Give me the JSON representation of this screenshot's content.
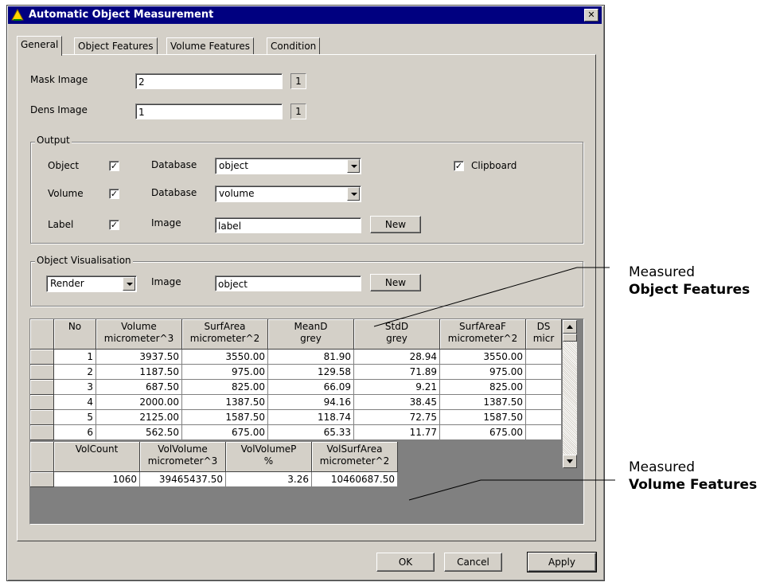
{
  "window": {
    "title": "Automatic Object Measurement",
    "close_glyph": "✕"
  },
  "tabs": [
    {
      "label": "General",
      "active": true
    },
    {
      "label": "Object Features",
      "active": false
    },
    {
      "label": "Volume Features",
      "active": false
    },
    {
      "label": "Condition",
      "active": false
    }
  ],
  "general": {
    "mask_image": {
      "label": "Mask Image",
      "value": "2",
      "channel": "1"
    },
    "dens_image": {
      "label": "Dens Image",
      "value": "1",
      "channel": "1"
    }
  },
  "output": {
    "group_label": "Output",
    "object": {
      "label": "Object",
      "checked": true,
      "field_label": "Database",
      "value": "object"
    },
    "volume": {
      "label": "Volume",
      "checked": true,
      "field_label": "Database",
      "value": "volume"
    },
    "label": {
      "label": "Label",
      "checked": true,
      "field_label": "Image",
      "value": "label",
      "button": "New"
    },
    "clipboard": {
      "label": "Clipboard",
      "checked": true
    }
  },
  "visualisation": {
    "group_label": "Object Visualisation",
    "mode": "Render",
    "field_label": "Image",
    "value": "object",
    "button": "New"
  },
  "object_table": {
    "headers": [
      {
        "top": "No",
        "bottom": ""
      },
      {
        "top": "Volume",
        "bottom": "micrometer^3"
      },
      {
        "top": "SurfArea",
        "bottom": "micrometer^2"
      },
      {
        "top": "MeanD",
        "bottom": "grey"
      },
      {
        "top": "StdD",
        "bottom": "grey"
      },
      {
        "top": "SurfAreaF",
        "bottom": "micrometer^2"
      },
      {
        "top": "DS",
        "bottom": "micr"
      }
    ],
    "rows": [
      [
        "1",
        "3937.50",
        "3550.00",
        "81.90",
        "28.94",
        "3550.00",
        ""
      ],
      [
        "2",
        "1187.50",
        "975.00",
        "129.58",
        "71.89",
        "975.00",
        ""
      ],
      [
        "3",
        "687.50",
        "825.00",
        "66.09",
        "9.21",
        "825.00",
        ""
      ],
      [
        "4",
        "2000.00",
        "1387.50",
        "94.16",
        "38.45",
        "1387.50",
        ""
      ],
      [
        "5",
        "2125.00",
        "1587.50",
        "118.74",
        "72.75",
        "1587.50",
        ""
      ],
      [
        "6",
        "562.50",
        "675.00",
        "65.33",
        "11.77",
        "675.00",
        ""
      ]
    ]
  },
  "volume_table": {
    "headers": [
      {
        "top": "VolCount",
        "bottom": ""
      },
      {
        "top": "VolVolume",
        "bottom": "micrometer^3"
      },
      {
        "top": "VolVolumeP",
        "bottom": "%"
      },
      {
        "top": "VolSurfArea",
        "bottom": "micrometer^2"
      }
    ],
    "rows": [
      [
        "1060",
        "39465437.50",
        "3.26",
        "10460687.50"
      ]
    ]
  },
  "buttons": {
    "ok": "OK",
    "cancel": "Cancel",
    "apply": "Apply"
  },
  "annotations": {
    "object": {
      "line1": "Measured",
      "line2": "Object Features"
    },
    "volume": {
      "line1": "Measured",
      "line2": "Volume Features"
    }
  }
}
